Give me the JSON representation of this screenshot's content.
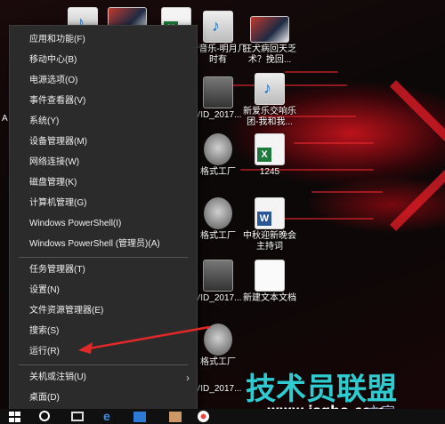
{
  "menu": {
    "items": [
      {
        "label": "应用和功能(F)"
      },
      {
        "label": "移动中心(B)"
      },
      {
        "label": "电源选项(O)"
      },
      {
        "label": "事件查看器(V)"
      },
      {
        "label": "系统(Y)"
      },
      {
        "label": "设备管理器(M)"
      },
      {
        "label": "网络连接(W)"
      },
      {
        "label": "磁盘管理(K)"
      },
      {
        "label": "计算机管理(G)"
      },
      {
        "label": "Windows PowerShell(I)"
      },
      {
        "label": "Windows PowerShell (管理员)(A)"
      },
      {
        "label": "任务管理器(T)"
      },
      {
        "label": "设置(N)"
      },
      {
        "label": "文件资源管理器(E)"
      },
      {
        "label": "搜索(S)"
      },
      {
        "label": "运行(R)"
      },
      {
        "label": "关机或注销(U)",
        "submenu_arrow": "›"
      },
      {
        "label": "桌面(D)"
      }
    ]
  },
  "desktop": {
    "icons": [
      {
        "label": "奇音乐-明月几时有",
        "icon": "media-file-icon"
      },
      {
        "label": "狂犬病回天乏术？挽回...",
        "icon": "video-thumbnail-icon"
      },
      {
        "label": "VID_2017...",
        "icon": "video-file-icon"
      },
      {
        "label": "新爱乐交响乐团-我和我...",
        "icon": "media-file-icon"
      },
      {
        "label": "格式工厂",
        "icon": "format-factory-icon"
      },
      {
        "label": "1245",
        "icon": "excel-file-icon"
      },
      {
        "label": "格式工厂",
        "icon": "format-factory-icon"
      },
      {
        "label": "中秋迎新晚会主持词",
        "icon": "word-file-icon"
      },
      {
        "label": "VID_2017...",
        "icon": "video-file-icon"
      },
      {
        "label": "新建文本文档",
        "icon": "text-file-icon"
      },
      {
        "label": "格式工厂",
        "icon": "format-factory-icon"
      },
      {
        "label": "VID_2017...",
        "icon": "video-file-icon"
      }
    ],
    "left_edge_letter": "A"
  },
  "watermark": {
    "title": "技术员联盟",
    "url": "www.jsgho.com",
    "tail": "之家"
  },
  "colors": {
    "menu_bg": "#2b2b2b",
    "menu_text": "#f0f0f0",
    "accent_red": "#e0202a",
    "watermark": "#2ecbd0"
  }
}
